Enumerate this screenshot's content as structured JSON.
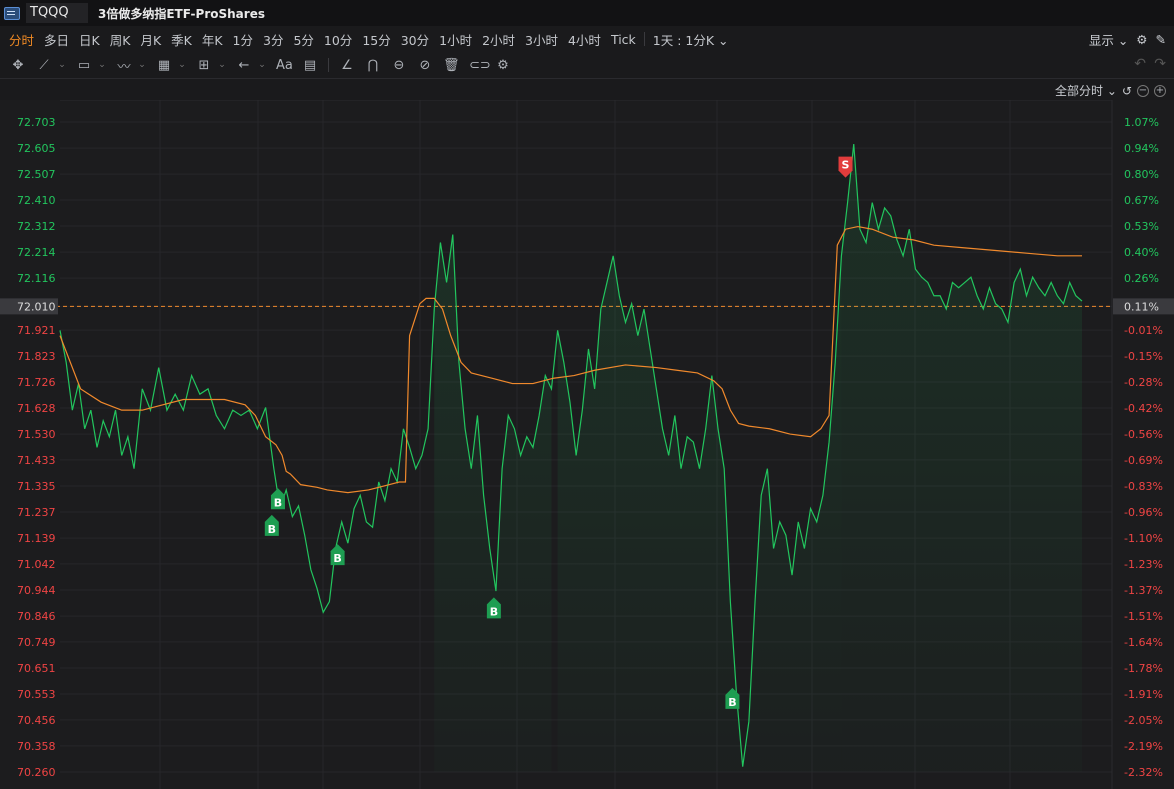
{
  "titlebar": {
    "ticker": "TQQQ",
    "name": "3倍做多纳指ETF-ProShares"
  },
  "periods": [
    "分时",
    "多日",
    "日K",
    "周K",
    "月K",
    "季K",
    "年K",
    "1分",
    "3分",
    "5分",
    "10分",
    "15分",
    "30分",
    "1小时",
    "2小时",
    "3小时",
    "4小时",
    "Tick"
  ],
  "active_period": "分时",
  "combo_period": "1天 : 1分K",
  "display_label": "显示",
  "range_label": "全部分时",
  "colors": {
    "up": "#22c55e",
    "down": "#ef4444",
    "avg": "#f0892c",
    "bg": "#1c1c1e",
    "buy": "#1e9e52",
    "sell": "#e23c3c"
  },
  "chart_data": {
    "type": "line",
    "prev_close": 72.01,
    "y_ticks": [
      72.703,
      72.605,
      72.507,
      72.41,
      72.312,
      72.214,
      72.116,
      72.01,
      71.921,
      71.823,
      71.726,
      71.628,
      71.53,
      71.433,
      71.335,
      71.237,
      71.139,
      71.042,
      70.944,
      70.846,
      70.749,
      70.651,
      70.553,
      70.456,
      70.358,
      70.26
    ],
    "pct_ticks": [
      "1.07%",
      "0.94%",
      "0.80%",
      "0.67%",
      "0.53%",
      "0.40%",
      "0.26%",
      "0.11%",
      "-0.01%",
      "-0.15%",
      "-0.28%",
      "-0.42%",
      "-0.56%",
      "-0.69%",
      "-0.83%",
      "-0.96%",
      "-1.10%",
      "-1.23%",
      "-1.37%",
      "-1.51%",
      "-1.64%",
      "-1.78%",
      "-1.91%",
      "-2.05%",
      "-2.19%",
      "-2.32%"
    ],
    "price_points": [
      [
        0,
        71.92
      ],
      [
        3,
        71.8
      ],
      [
        6,
        71.62
      ],
      [
        9,
        71.72
      ],
      [
        12,
        71.55
      ],
      [
        15,
        71.62
      ],
      [
        18,
        71.48
      ],
      [
        21,
        71.58
      ],
      [
        24,
        71.52
      ],
      [
        27,
        71.62
      ],
      [
        30,
        71.45
      ],
      [
        33,
        71.52
      ],
      [
        36,
        71.4
      ],
      [
        40,
        71.7
      ],
      [
        44,
        71.62
      ],
      [
        48,
        71.78
      ],
      [
        52,
        71.62
      ],
      [
        56,
        71.68
      ],
      [
        60,
        71.62
      ],
      [
        64,
        71.75
      ],
      [
        68,
        71.68
      ],
      [
        72,
        71.7
      ],
      [
        76,
        71.6
      ],
      [
        80,
        71.55
      ],
      [
        84,
        71.62
      ],
      [
        88,
        71.6
      ],
      [
        92,
        71.62
      ],
      [
        96,
        71.55
      ],
      [
        100,
        71.63
      ],
      [
        104,
        71.4
      ],
      [
        107,
        71.25
      ],
      [
        110,
        71.32
      ],
      [
        113,
        71.22
      ],
      [
        116,
        71.26
      ],
      [
        119,
        71.15
      ],
      [
        122,
        71.02
      ],
      [
        125,
        70.95
      ],
      [
        128,
        70.86
      ],
      [
        131,
        70.9
      ],
      [
        134,
        71.1
      ],
      [
        137,
        71.2
      ],
      [
        140,
        71.12
      ],
      [
        143,
        71.25
      ],
      [
        146,
        71.3
      ],
      [
        149,
        71.2
      ],
      [
        152,
        71.18
      ],
      [
        155,
        71.35
      ],
      [
        158,
        71.28
      ],
      [
        161,
        71.4
      ],
      [
        164,
        71.35
      ],
      [
        167,
        71.55
      ],
      [
        170,
        71.48
      ],
      [
        173,
        71.4
      ],
      [
        176,
        71.45
      ],
      [
        179,
        71.55
      ],
      [
        182,
        72.0
      ],
      [
        185,
        72.25
      ],
      [
        188,
        72.1
      ],
      [
        191,
        72.28
      ],
      [
        194,
        71.8
      ],
      [
        197,
        71.55
      ],
      [
        200,
        71.4
      ],
      [
        203,
        71.6
      ],
      [
        206,
        71.3
      ],
      [
        209,
        71.1
      ],
      [
        212,
        70.94
      ],
      [
        215,
        71.4
      ],
      [
        218,
        71.6
      ],
      [
        221,
        71.55
      ],
      [
        224,
        71.45
      ],
      [
        227,
        71.52
      ],
      [
        230,
        71.48
      ],
      [
        233,
        71.6
      ],
      [
        236,
        71.75
      ],
      [
        239,
        71.7
      ],
      [
        242,
        71.92
      ],
      [
        245,
        71.8
      ],
      [
        248,
        71.65
      ],
      [
        251,
        71.45
      ],
      [
        254,
        71.62
      ],
      [
        257,
        71.85
      ],
      [
        260,
        71.7
      ],
      [
        263,
        72.0
      ],
      [
        266,
        72.1
      ],
      [
        269,
        72.2
      ],
      [
        272,
        72.05
      ],
      [
        275,
        71.95
      ],
      [
        278,
        72.02
      ],
      [
        281,
        71.9
      ],
      [
        284,
        72.0
      ],
      [
        287,
        71.85
      ],
      [
        290,
        71.7
      ],
      [
        293,
        71.55
      ],
      [
        296,
        71.45
      ],
      [
        299,
        71.6
      ],
      [
        302,
        71.4
      ],
      [
        305,
        71.52
      ],
      [
        308,
        71.5
      ],
      [
        311,
        71.4
      ],
      [
        314,
        71.55
      ],
      [
        317,
        71.75
      ],
      [
        320,
        71.55
      ],
      [
        323,
        71.4
      ],
      [
        326,
        70.9
      ],
      [
        329,
        70.55
      ],
      [
        332,
        70.28
      ],
      [
        335,
        70.45
      ],
      [
        338,
        70.9
      ],
      [
        341,
        71.3
      ],
      [
        344,
        71.4
      ],
      [
        347,
        71.1
      ],
      [
        350,
        71.2
      ],
      [
        353,
        71.15
      ],
      [
        356,
        71.0
      ],
      [
        359,
        71.2
      ],
      [
        362,
        71.1
      ],
      [
        365,
        71.25
      ],
      [
        368,
        71.2
      ],
      [
        371,
        71.3
      ],
      [
        374,
        71.5
      ],
      [
        377,
        71.8
      ],
      [
        380,
        72.2
      ],
      [
        383,
        72.4
      ],
      [
        386,
        72.62
      ],
      [
        389,
        72.3
      ],
      [
        392,
        72.25
      ],
      [
        395,
        72.4
      ],
      [
        398,
        72.3
      ],
      [
        401,
        72.38
      ],
      [
        404,
        72.35
      ],
      [
        407,
        72.26
      ],
      [
        410,
        72.2
      ],
      [
        413,
        72.3
      ],
      [
        416,
        72.15
      ],
      [
        419,
        72.12
      ],
      [
        422,
        72.1
      ],
      [
        425,
        72.05
      ],
      [
        428,
        72.05
      ],
      [
        431,
        72.0
      ],
      [
        434,
        72.1
      ],
      [
        437,
        72.08
      ],
      [
        440,
        72.1
      ],
      [
        443,
        72.12
      ],
      [
        446,
        72.05
      ],
      [
        449,
        72.0
      ],
      [
        452,
        72.08
      ],
      [
        455,
        72.02
      ],
      [
        458,
        72.0
      ],
      [
        461,
        71.95
      ],
      [
        464,
        72.1
      ],
      [
        467,
        72.15
      ],
      [
        470,
        72.05
      ],
      [
        473,
        72.12
      ],
      [
        476,
        72.08
      ],
      [
        479,
        72.05
      ],
      [
        482,
        72.1
      ],
      [
        485,
        72.05
      ],
      [
        488,
        72.02
      ],
      [
        491,
        72.1
      ],
      [
        494,
        72.05
      ],
      [
        497,
        72.03
      ]
    ],
    "avg_points": [
      [
        0,
        71.9
      ],
      [
        10,
        71.7
      ],
      [
        20,
        71.65
      ],
      [
        30,
        71.62
      ],
      [
        40,
        71.62
      ],
      [
        50,
        71.64
      ],
      [
        60,
        71.66
      ],
      [
        70,
        71.66
      ],
      [
        80,
        71.66
      ],
      [
        90,
        71.64
      ],
      [
        95,
        71.6
      ],
      [
        100,
        71.52
      ],
      [
        105,
        71.49
      ],
      [
        108,
        71.45
      ],
      [
        110,
        71.39
      ],
      [
        112,
        71.38
      ],
      [
        117,
        71.34
      ],
      [
        125,
        71.33
      ],
      [
        130,
        71.32
      ],
      [
        140,
        71.31
      ],
      [
        150,
        71.32
      ],
      [
        160,
        71.34
      ],
      [
        165,
        71.35
      ],
      [
        168,
        71.35
      ],
      [
        170,
        71.9
      ],
      [
        175,
        72.02
      ],
      [
        178,
        72.04
      ],
      [
        182,
        72.04
      ],
      [
        186,
        72.0
      ],
      [
        190,
        71.9
      ],
      [
        195,
        71.8
      ],
      [
        200,
        71.76
      ],
      [
        210,
        71.74
      ],
      [
        220,
        71.72
      ],
      [
        230,
        71.72
      ],
      [
        240,
        71.74
      ],
      [
        250,
        71.75
      ],
      [
        260,
        71.77
      ],
      [
        275,
        71.79
      ],
      [
        290,
        71.78
      ],
      [
        300,
        71.77
      ],
      [
        310,
        71.76
      ],
      [
        318,
        71.73
      ],
      [
        322,
        71.7
      ],
      [
        326,
        71.62
      ],
      [
        330,
        71.57
      ],
      [
        335,
        71.56
      ],
      [
        345,
        71.55
      ],
      [
        355,
        71.53
      ],
      [
        365,
        71.52
      ],
      [
        370,
        71.55
      ],
      [
        374,
        71.6
      ],
      [
        378,
        72.24
      ],
      [
        382,
        72.3
      ],
      [
        388,
        72.31
      ],
      [
        395,
        72.3
      ],
      [
        405,
        72.27
      ],
      [
        415,
        72.26
      ],
      [
        425,
        72.24
      ],
      [
        440,
        72.23
      ],
      [
        455,
        72.22
      ],
      [
        470,
        72.21
      ],
      [
        485,
        72.2
      ],
      [
        497,
        72.2
      ]
    ],
    "signals": [
      {
        "type": "B",
        "x": 103,
        "price": 71.23
      },
      {
        "type": "B",
        "x": 106,
        "price": 71.33
      },
      {
        "type": "B",
        "x": 135,
        "price": 71.12
      },
      {
        "type": "B",
        "x": 211,
        "price": 70.92
      },
      {
        "type": "B",
        "x": 327,
        "price": 70.58
      },
      {
        "type": "S",
        "x": 382,
        "price": 72.49
      }
    ]
  }
}
